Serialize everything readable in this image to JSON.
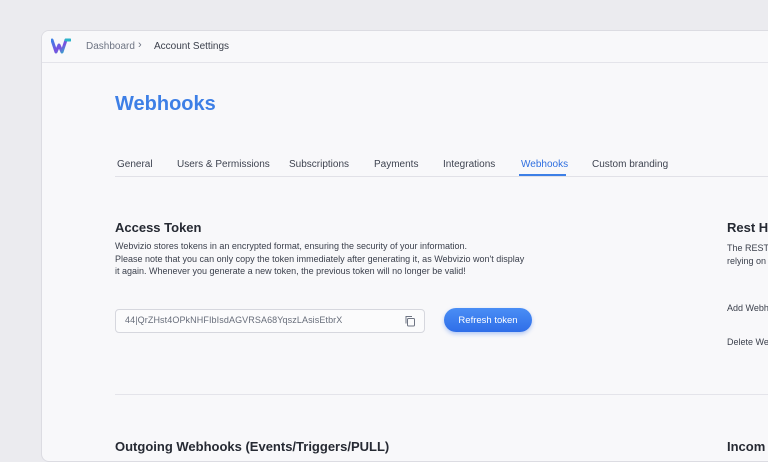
{
  "breadcrumb": {
    "home": "Dashboard",
    "separator": "›",
    "current": "Account Settings"
  },
  "page": {
    "title": "Webhooks"
  },
  "tabs": [
    {
      "label": "General"
    },
    {
      "label": "Users & Permissions"
    },
    {
      "label": "Subscriptions"
    },
    {
      "label": "Payments"
    },
    {
      "label": "Integrations"
    },
    {
      "label": "Webhooks",
      "active": true
    },
    {
      "label": "Custom branding"
    }
  ],
  "access_token": {
    "title": "Access Token",
    "description": [
      "Webvizio stores tokens in an encrypted format, ensuring the security of your information.",
      "Please note that you can only copy the token immediately after generating it, as Webvizio won't display",
      "it again. Whenever you generate a new token, the previous token will no longer be valid!"
    ],
    "token_value": "44|QrZHst4OPkNHFIbIsdAGVRSA68YqszLAsisEtbrX",
    "refresh_label": "Refresh token"
  },
  "rest_hooks": {
    "title": "Rest Ho",
    "desc_line1": "The REST",
    "desc_line2": "relying on",
    "add_label": "Add Webh",
    "delete_label": "Delete We"
  },
  "bottom": {
    "left_title": "Outgoing Webhooks (Events/Triggers/PULL)",
    "right_title": "Incom"
  },
  "colors": {
    "accent": "#3d7fe6",
    "background": "#f8f8fa"
  }
}
